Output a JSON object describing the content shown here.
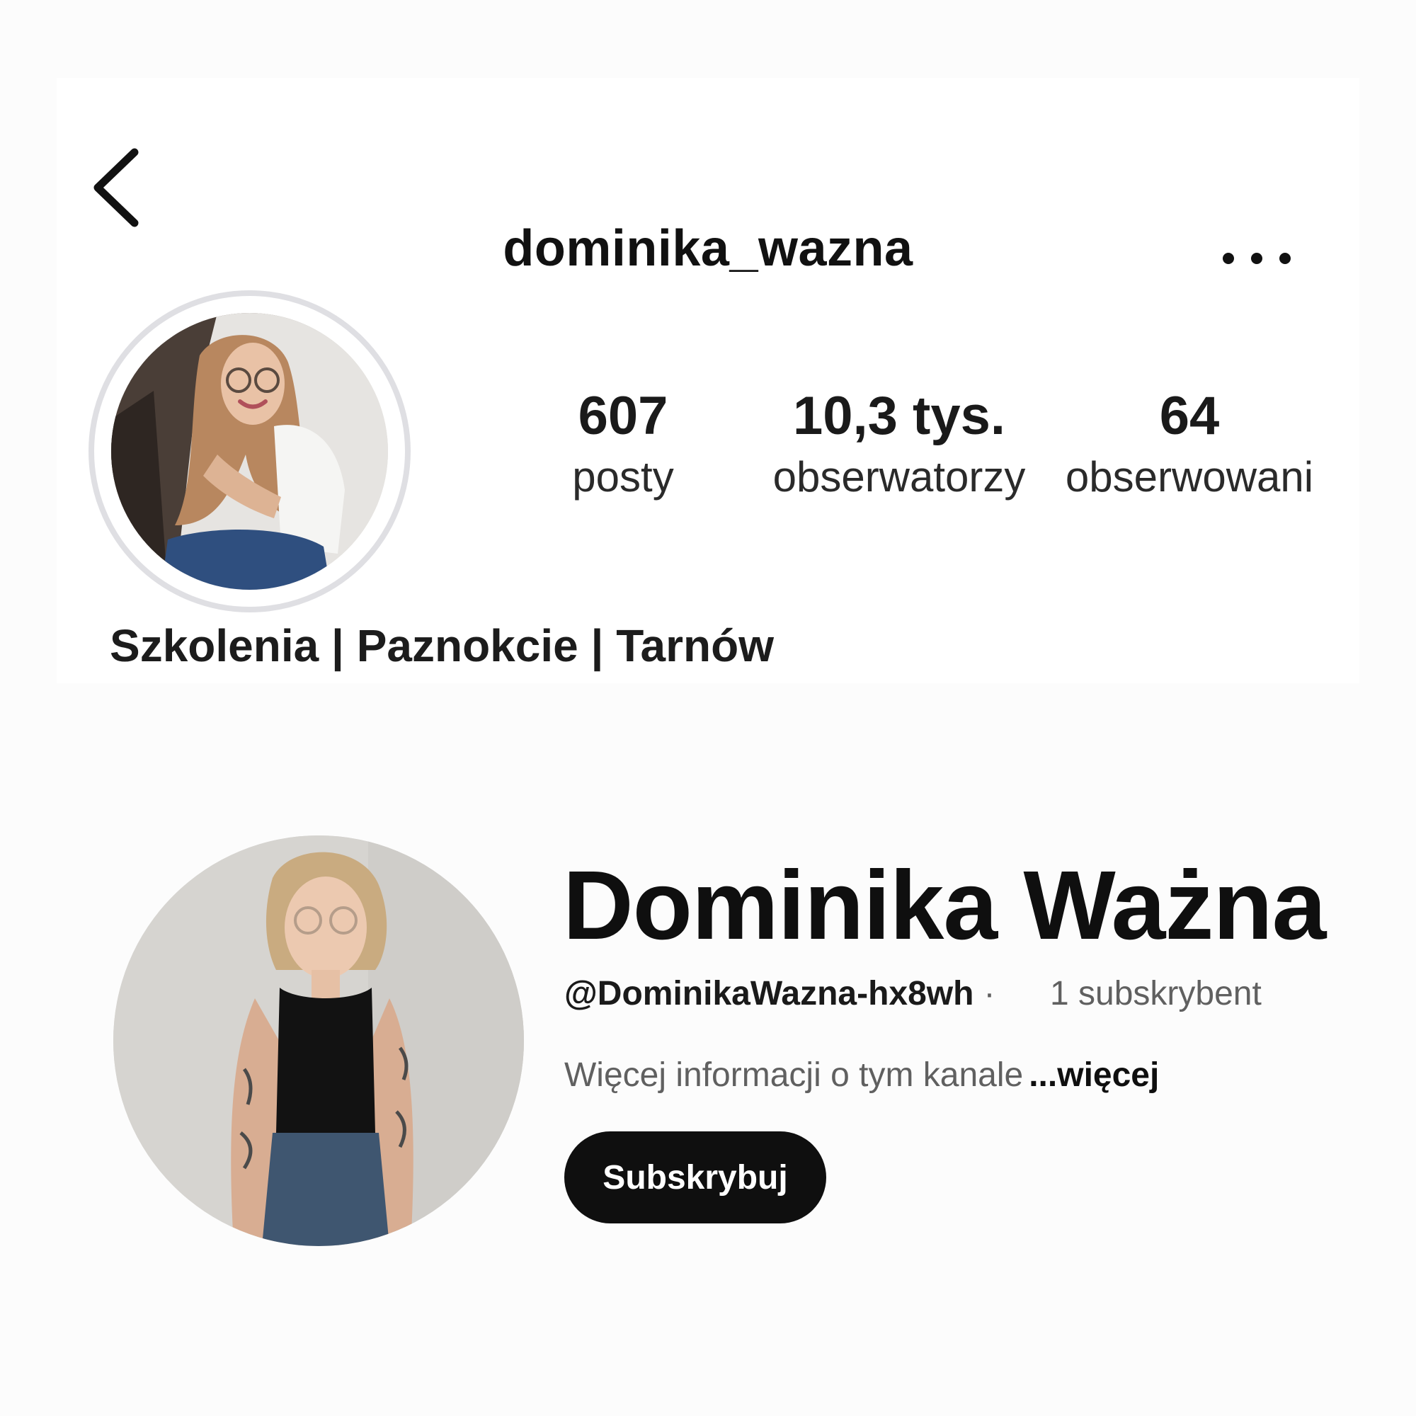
{
  "instagram": {
    "username": "dominika_wazna",
    "stats": [
      {
        "value": "607",
        "label": "posty"
      },
      {
        "value": "10,3 tys.",
        "label": "obserwatorzy"
      },
      {
        "value": "64",
        "label": "obserwowani"
      }
    ],
    "bio": "Szkolenia | Paznokcie | Tarnów",
    "icons": {
      "back": "chevron-left-icon",
      "more": "more-horizontal-icon"
    }
  },
  "youtube": {
    "channel_name": "Dominika Ważna",
    "handle": "@DominikaWazna-hx8wh",
    "separator": "·",
    "subscribers": "1 subskrybent",
    "about": "Więcej informacji o tym kanale",
    "more_label": "...więcej",
    "subscribe_label": "Subskrybuj"
  },
  "colors": {
    "background": "#fcfcfc",
    "text_primary": "#111111",
    "text_secondary": "#606060",
    "avatar_ring": "#dfdfe3",
    "subscribe_bg": "#0f0f0f",
    "subscribe_text": "#ffffff"
  }
}
